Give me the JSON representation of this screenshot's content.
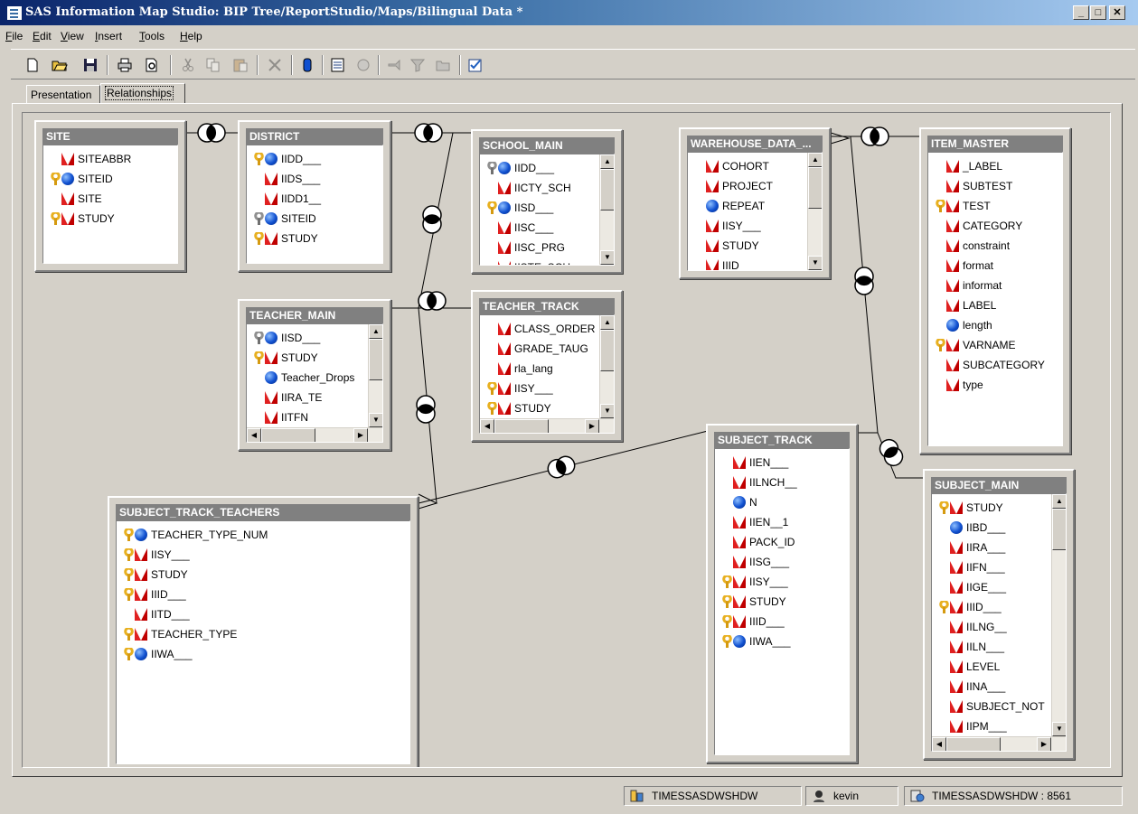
{
  "window": {
    "title": "SAS Information Map Studio: BIP Tree/ReportStudio/Maps/Bilingual Data *"
  },
  "menu": [
    {
      "pre": "",
      "u": "F",
      "post": "ile"
    },
    {
      "pre": "",
      "u": "E",
      "post": "dit"
    },
    {
      "pre": "",
      "u": "V",
      "post": "iew"
    },
    {
      "pre": "",
      "u": "I",
      "post": "nsert"
    },
    {
      "pre": "",
      "u": "T",
      "post": "ools"
    },
    {
      "pre": "",
      "u": "H",
      "post": "elp"
    }
  ],
  "toolbar": {
    "buttons": [
      "new-icon",
      "open-folder-icon",
      "save-icon",
      "print-icon",
      "print-preview-icon",
      "cut-icon",
      "copy-icon",
      "paste-icon",
      "delete-icon",
      "data-source-icon",
      "properties-icon",
      "new-filter-icon",
      "assign-icon",
      "filter-icon",
      "folder-icon",
      "test-icon"
    ]
  },
  "tabs": [
    {
      "label": "Presentation",
      "active": false
    },
    {
      "label": "Relationships",
      "active": true
    }
  ],
  "tables": [
    {
      "name": "SITE",
      "scroll": false,
      "cols": [
        {
          "key": "",
          "type": "c",
          "name": "SITEABBR"
        },
        {
          "key": "g",
          "type": "n",
          "name": "SITEID"
        },
        {
          "key": "",
          "type": "c",
          "name": "SITE"
        },
        {
          "key": "g",
          "type": "c",
          "name": "STUDY"
        }
      ]
    },
    {
      "name": "DISTRICT",
      "scroll": false,
      "cols": [
        {
          "key": "g",
          "type": "n",
          "name": "IIDD___"
        },
        {
          "key": "",
          "type": "c",
          "name": "IIDS___"
        },
        {
          "key": "",
          "type": "c",
          "name": "IIDD1__"
        },
        {
          "key": "s",
          "type": "n",
          "name": "SITEID"
        },
        {
          "key": "g",
          "type": "c",
          "name": "STUDY"
        }
      ]
    },
    {
      "name": "SCHOOL_MAIN",
      "scroll": "v",
      "cols": [
        {
          "key": "s",
          "type": "n",
          "name": "IIDD___"
        },
        {
          "key": "",
          "type": "c",
          "name": "IICTY_SCH"
        },
        {
          "key": "g",
          "type": "n",
          "name": "IISD___"
        },
        {
          "key": "",
          "type": "c",
          "name": "IISC___"
        },
        {
          "key": "",
          "type": "c",
          "name": "IISC_PRG"
        },
        {
          "key": "",
          "type": "c",
          "name": "IISTE_SCH"
        }
      ]
    },
    {
      "name": "WAREHOUSE_DATA_...",
      "scroll": "v",
      "cols": [
        {
          "key": "",
          "type": "c",
          "name": "COHORT"
        },
        {
          "key": "",
          "type": "c",
          "name": "PROJECT"
        },
        {
          "key": "",
          "type": "n",
          "name": "REPEAT"
        },
        {
          "key": "",
          "type": "c",
          "name": "IISY___"
        },
        {
          "key": "",
          "type": "c",
          "name": "STUDY"
        },
        {
          "key": "",
          "type": "c",
          "name": "IIID___"
        }
      ]
    },
    {
      "name": "ITEM_MASTER",
      "scroll": false,
      "cols": [
        {
          "key": "",
          "type": "c",
          "name": "_LABEL"
        },
        {
          "key": "",
          "type": "c",
          "name": "SUBTEST"
        },
        {
          "key": "g",
          "type": "c",
          "name": "TEST"
        },
        {
          "key": "",
          "type": "c",
          "name": "CATEGORY"
        },
        {
          "key": "",
          "type": "c",
          "name": "constraint"
        },
        {
          "key": "",
          "type": "c",
          "name": "format"
        },
        {
          "key": "",
          "type": "c",
          "name": "informat"
        },
        {
          "key": "",
          "type": "c",
          "name": "LABEL"
        },
        {
          "key": "",
          "type": "n",
          "name": "length"
        },
        {
          "key": "g",
          "type": "c",
          "name": "VARNAME"
        },
        {
          "key": "",
          "type": "c",
          "name": "SUBCATEGORY"
        },
        {
          "key": "",
          "type": "c",
          "name": "type"
        }
      ]
    },
    {
      "name": "TEACHER_MAIN",
      "scroll": "vh",
      "cols": [
        {
          "key": "s",
          "type": "n",
          "name": "IISD___"
        },
        {
          "key": "g",
          "type": "c",
          "name": "STUDY"
        },
        {
          "key": "",
          "type": "n",
          "name": "Teacher_Drops"
        },
        {
          "key": "",
          "type": "c",
          "name": "IIRA_TE"
        },
        {
          "key": "",
          "type": "c",
          "name": "IITFN"
        }
      ]
    },
    {
      "name": "TEACHER_TRACK",
      "scroll": "vh",
      "cols": [
        {
          "key": "",
          "type": "c",
          "name": "CLASS_ORDER"
        },
        {
          "key": "",
          "type": "c",
          "name": "GRADE_TAUG"
        },
        {
          "key": "",
          "type": "c",
          "name": "rla_lang"
        },
        {
          "key": "g",
          "type": "c",
          "name": "IISY___"
        },
        {
          "key": "g",
          "type": "c",
          "name": "STUDY"
        }
      ]
    },
    {
      "name": "SUBJECT_TRACK",
      "scroll": false,
      "cols": [
        {
          "key": "",
          "type": "c",
          "name": "IIEN___"
        },
        {
          "key": "",
          "type": "c",
          "name": "IILNCH__"
        },
        {
          "key": "",
          "type": "n",
          "name": "N"
        },
        {
          "key": "",
          "type": "c",
          "name": "IIEN__1"
        },
        {
          "key": "",
          "type": "c",
          "name": "PACK_ID"
        },
        {
          "key": "",
          "type": "c",
          "name": "IISG___"
        },
        {
          "key": "g",
          "type": "c",
          "name": "IISY___"
        },
        {
          "key": "g",
          "type": "c",
          "name": "STUDY"
        },
        {
          "key": "g",
          "type": "c",
          "name": "IIID___"
        },
        {
          "key": "g",
          "type": "n",
          "name": "IIWA___"
        }
      ]
    },
    {
      "name": "SUBJECT_TRACK_TEACHERS",
      "scroll": false,
      "cols": [
        {
          "key": "g",
          "type": "n",
          "name": "TEACHER_TYPE_NUM"
        },
        {
          "key": "g",
          "type": "c",
          "name": "IISY___"
        },
        {
          "key": "g",
          "type": "c",
          "name": "STUDY"
        },
        {
          "key": "g",
          "type": "c",
          "name": "IIID___"
        },
        {
          "key": "",
          "type": "c",
          "name": "IITD___"
        },
        {
          "key": "g",
          "type": "c",
          "name": "TEACHER_TYPE"
        },
        {
          "key": "g",
          "type": "n",
          "name": "IIWA___"
        }
      ]
    },
    {
      "name": "SUBJECT_MAIN",
      "scroll": "vh",
      "cols": [
        {
          "key": "g",
          "type": "c",
          "name": "STUDY"
        },
        {
          "key": "",
          "type": "n",
          "name": "IIBD___"
        },
        {
          "key": "",
          "type": "c",
          "name": "IIRA___"
        },
        {
          "key": "",
          "type": "c",
          "name": "IIFN___"
        },
        {
          "key": "",
          "type": "c",
          "name": "IIGE___"
        },
        {
          "key": "g",
          "type": "c",
          "name": "IIID___"
        },
        {
          "key": "",
          "type": "c",
          "name": "IILNG__"
        },
        {
          "key": "",
          "type": "c",
          "name": "IILN___"
        },
        {
          "key": "",
          "type": "c",
          "name": "LEVEL"
        },
        {
          "key": "",
          "type": "c",
          "name": "IINA___"
        },
        {
          "key": "",
          "type": "c",
          "name": "SUBJECT_NOT"
        },
        {
          "key": "",
          "type": "c",
          "name": "IIPM___"
        }
      ]
    }
  ],
  "status": [
    {
      "icon": "server-icon",
      "text": "TIMESSASDWSHDW"
    },
    {
      "icon": "user-icon",
      "text": "kevin"
    },
    {
      "icon": "connection-icon",
      "text": "TIMESSASDWSHDW : 8561"
    }
  ]
}
